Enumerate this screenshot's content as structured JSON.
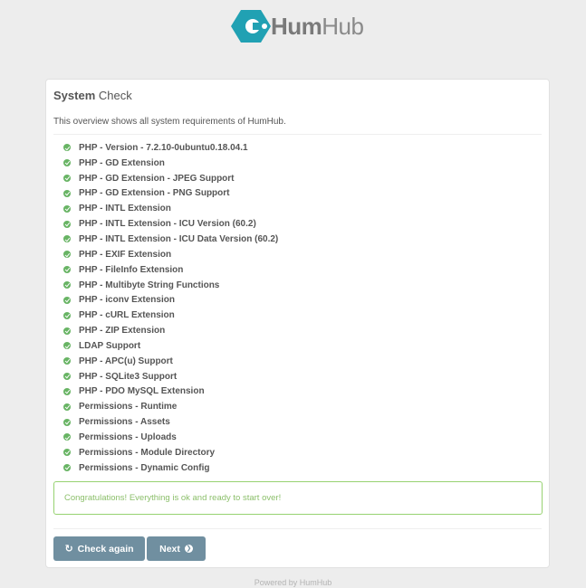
{
  "logo": {
    "text_bold": "Hum",
    "text_light": "Hub",
    "brand_color": "#21a1b3",
    "icon": "humhub-logo-icon"
  },
  "panel": {
    "title_bold": "System",
    "title_rest": "Check",
    "intro": "This overview shows all system requirements of HumHub.",
    "checks": [
      {
        "label": "PHP - Version - 7.2.10-0ubuntu0.18.04.1",
        "status": "ok"
      },
      {
        "label": "PHP - GD Extension",
        "status": "ok"
      },
      {
        "label": "PHP - GD Extension - JPEG Support",
        "status": "ok"
      },
      {
        "label": "PHP - GD Extension - PNG Support",
        "status": "ok"
      },
      {
        "label": "PHP - INTL Extension",
        "status": "ok"
      },
      {
        "label": "PHP - INTL Extension - ICU Version (60.2)",
        "status": "ok"
      },
      {
        "label": "PHP - INTL Extension - ICU Data Version (60.2)",
        "status": "ok"
      },
      {
        "label": "PHP - EXIF Extension",
        "status": "ok"
      },
      {
        "label": "PHP - FileInfo Extension",
        "status": "ok"
      },
      {
        "label": "PHP - Multibyte String Functions",
        "status": "ok"
      },
      {
        "label": "PHP - iconv Extension",
        "status": "ok"
      },
      {
        "label": "PHP - cURL Extension",
        "status": "ok"
      },
      {
        "label": "PHP - ZIP Extension",
        "status": "ok"
      },
      {
        "label": "LDAP Support",
        "status": "ok"
      },
      {
        "label": "PHP - APC(u) Support",
        "status": "ok"
      },
      {
        "label": "PHP - SQLite3 Support",
        "status": "ok"
      },
      {
        "label": "PHP - PDO MySQL Extension",
        "status": "ok"
      },
      {
        "label": "Permissions - Runtime",
        "status": "ok"
      },
      {
        "label": "Permissions - Assets",
        "status": "ok"
      },
      {
        "label": "Permissions - Uploads",
        "status": "ok"
      },
      {
        "label": "Permissions - Module Directory",
        "status": "ok"
      },
      {
        "label": "Permissions - Dynamic Config",
        "status": "ok"
      }
    ],
    "success_message": "Congratulations! Everything is ok and ready to start over!",
    "check_again_label": "Check again",
    "check_again_icon": "refresh-icon",
    "next_label": "Next",
    "next_icon": "arrow-circle-right-icon"
  },
  "colors": {
    "ok": "#68b464",
    "button": "#708fa0",
    "success_border": "#97d271",
    "success_text": "#8bbf6a"
  },
  "footer": "Powered by HumHub"
}
